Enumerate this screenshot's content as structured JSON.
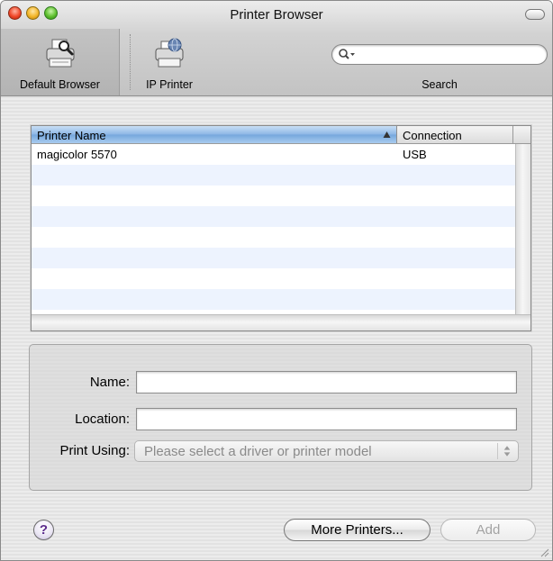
{
  "window": {
    "title": "Printer Browser"
  },
  "toolbar": {
    "items": [
      {
        "label": "Default Browser",
        "icon": "printer-search-icon",
        "selected": true
      },
      {
        "label": "IP Printer",
        "icon": "printer-globe-icon",
        "selected": false
      }
    ],
    "search": {
      "value": "",
      "placeholder": "",
      "label": "Search"
    }
  },
  "printer_list": {
    "columns": [
      {
        "label": "Printer Name",
        "sort": "ascending"
      },
      {
        "label": "Connection"
      }
    ],
    "rows": [
      {
        "name": "magicolor 5570",
        "connection": "USB"
      }
    ]
  },
  "details": {
    "name_label": "Name:",
    "name_value": "",
    "location_label": "Location:",
    "location_value": "",
    "print_using_label": "Print Using:",
    "print_using_value": "Please select a driver or printer model"
  },
  "footer": {
    "help_label": "?",
    "more_printers_label": "More Printers...",
    "add_label": "Add",
    "add_enabled": false
  },
  "colors": {
    "header_selected": "#8cb6e4",
    "row_stripe": "#edf3fe",
    "help_glyph": "#5c2b8c"
  }
}
